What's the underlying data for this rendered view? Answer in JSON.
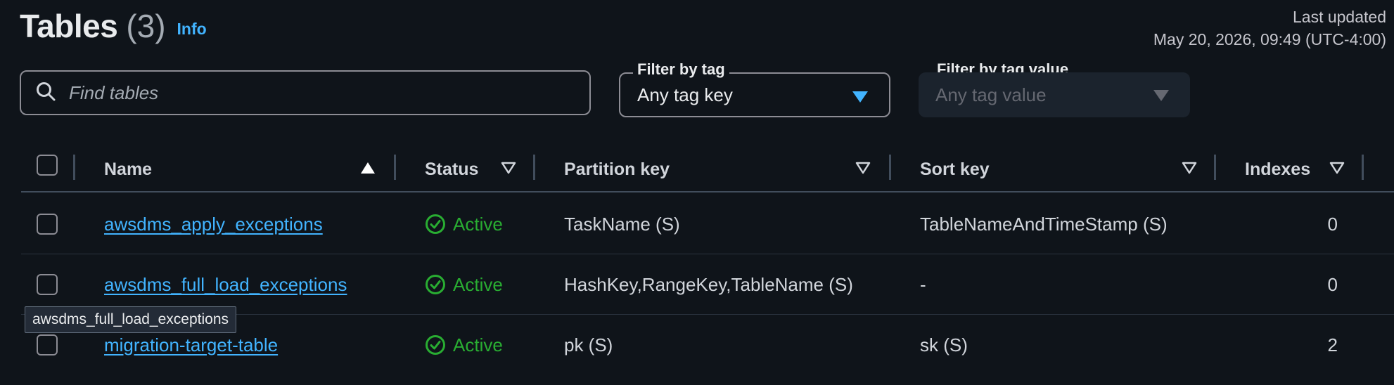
{
  "header": {
    "title": "Tables",
    "count": "(3)",
    "info_label": "Info",
    "last_updated_label": "Last updated",
    "last_updated_value": "May 20, 2026, 09:49 (UTC-4:00)"
  },
  "search": {
    "placeholder": "Find tables"
  },
  "filters": {
    "tag_key_label": "Filter by tag",
    "tag_key_value": "Any tag key",
    "tag_value_label": "Filter by tag value",
    "tag_value_placeholder": "Any tag value"
  },
  "columns": {
    "name": "Name",
    "status": "Status",
    "partition_key": "Partition key",
    "sort_key": "Sort key",
    "indexes": "Indexes"
  },
  "rows": [
    {
      "name": "awsdms_apply_exceptions",
      "status": "Active",
      "partition_key": "TaskName (S)",
      "sort_key": "TableNameAndTimeStamp (S)",
      "indexes": "0"
    },
    {
      "name": "awsdms_full_load_exceptions",
      "status": "Active",
      "partition_key": "HashKey,RangeKey,TableName (S)",
      "sort_key": "-",
      "indexes": "0"
    },
    {
      "name": "migration-target-table",
      "status": "Active",
      "partition_key": "pk (S)",
      "sort_key": "sk (S)",
      "indexes": "2"
    }
  ],
  "tooltip": "awsdms_full_load_exceptions",
  "colors": {
    "background": "#0f141a",
    "link": "#42b4ff",
    "success": "#29ad32",
    "border": "#8c8c94"
  },
  "icons": {
    "search": "search-icon",
    "sort_ascending": "sort-ascending-icon",
    "sort_descending": "caret-down-outline-icon",
    "status_success": "status-positive-icon"
  }
}
